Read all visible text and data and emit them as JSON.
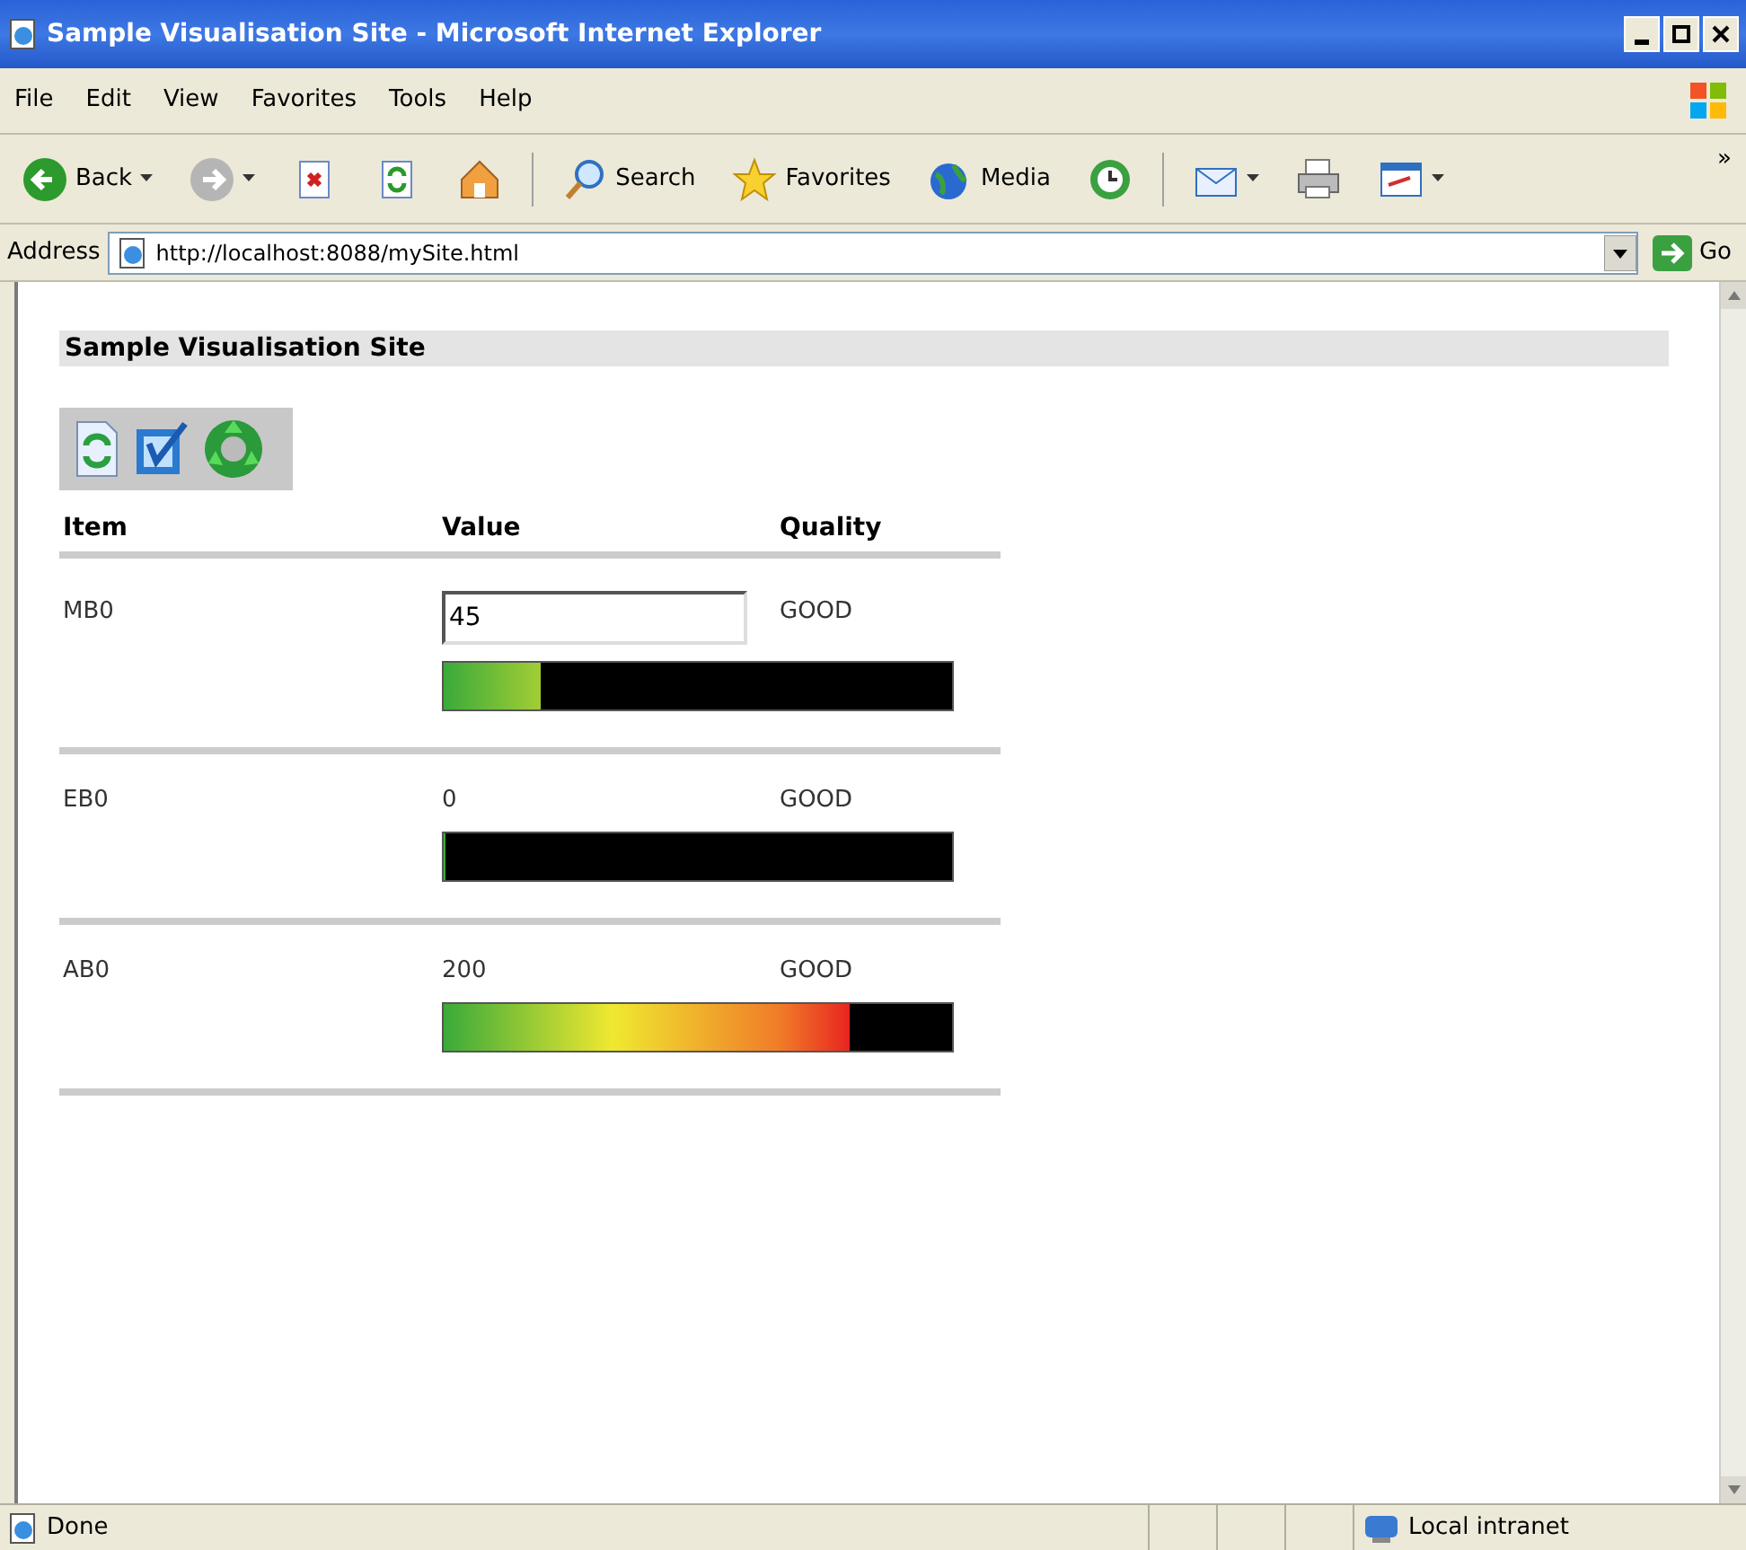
{
  "window": {
    "title": "Sample Visualisation Site - Microsoft Internet Explorer"
  },
  "menu": [
    "File",
    "Edit",
    "View",
    "Favorites",
    "Tools",
    "Help"
  ],
  "toolbar": [
    {
      "kind": "back",
      "label": "Back"
    },
    {
      "kind": "forward"
    },
    {
      "kind": "stop"
    },
    {
      "kind": "refresh"
    },
    {
      "kind": "home"
    },
    {
      "kind": "search",
      "label": "Search"
    },
    {
      "kind": "favorites",
      "label": "Favorites"
    },
    {
      "kind": "media",
      "label": "Media"
    },
    {
      "kind": "history"
    },
    {
      "kind": "mail"
    },
    {
      "kind": "print"
    },
    {
      "kind": "edit"
    }
  ],
  "toolbar_more": "»",
  "address": {
    "label": "Address",
    "url": "http://localhost:8088/mySite.html",
    "go": "Go"
  },
  "page": {
    "heading": "Sample Visualisation Site",
    "columns": [
      "Item",
      "Value",
      "Quality"
    ],
    "rows": [
      {
        "item": "MB0",
        "kind": "input",
        "value": "45",
        "quality": "GOOD",
        "level": 0.19
      },
      {
        "item": "EB0",
        "kind": "text",
        "value": "0",
        "quality": "GOOD",
        "level": 0
      },
      {
        "item": "AB0",
        "kind": "text",
        "value": "200",
        "quality": "GOOD",
        "level": 0.8
      }
    ]
  },
  "status_bar": {
    "text": "Done",
    "zone": "Local intranet"
  }
}
